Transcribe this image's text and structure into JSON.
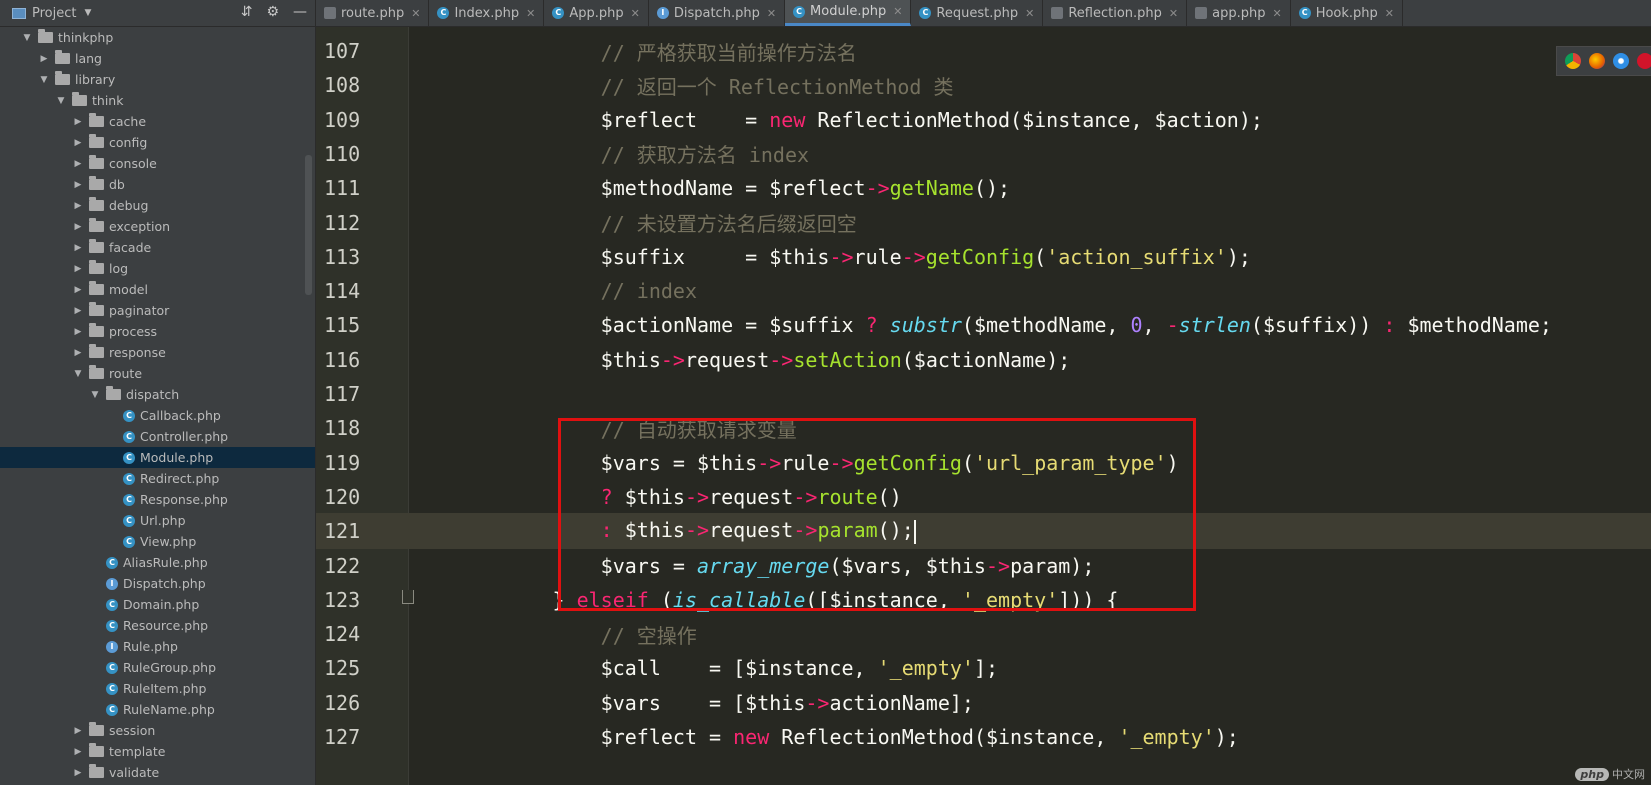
{
  "sidebar": {
    "title": "Project",
    "tree": [
      {
        "label": "thinkphp",
        "type": "folder",
        "depth": 0,
        "open": true
      },
      {
        "label": "lang",
        "type": "folder",
        "depth": 1,
        "open": false
      },
      {
        "label": "library",
        "type": "folder",
        "depth": 1,
        "open": true
      },
      {
        "label": "think",
        "type": "folder",
        "depth": 2,
        "open": true
      },
      {
        "label": "cache",
        "type": "folder",
        "depth": 3,
        "open": false
      },
      {
        "label": "config",
        "type": "folder",
        "depth": 3,
        "open": false
      },
      {
        "label": "console",
        "type": "folder",
        "depth": 3,
        "open": false
      },
      {
        "label": "db",
        "type": "folder",
        "depth": 3,
        "open": false
      },
      {
        "label": "debug",
        "type": "folder",
        "depth": 3,
        "open": false
      },
      {
        "label": "exception",
        "type": "folder",
        "depth": 3,
        "open": false
      },
      {
        "label": "facade",
        "type": "folder",
        "depth": 3,
        "open": false
      },
      {
        "label": "log",
        "type": "folder",
        "depth": 3,
        "open": false
      },
      {
        "label": "model",
        "type": "folder",
        "depth": 3,
        "open": false
      },
      {
        "label": "paginator",
        "type": "folder",
        "depth": 3,
        "open": false
      },
      {
        "label": "process",
        "type": "folder",
        "depth": 3,
        "open": false
      },
      {
        "label": "response",
        "type": "folder",
        "depth": 3,
        "open": false
      },
      {
        "label": "route",
        "type": "folder",
        "depth": 3,
        "open": true
      },
      {
        "label": "dispatch",
        "type": "folder",
        "depth": 4,
        "open": true
      },
      {
        "label": "Callback.php",
        "type": "php",
        "depth": 5
      },
      {
        "label": "Controller.php",
        "type": "php",
        "depth": 5
      },
      {
        "label": "Module.php",
        "type": "php",
        "depth": 5,
        "selected": true
      },
      {
        "label": "Redirect.php",
        "type": "php",
        "depth": 5
      },
      {
        "label": "Response.php",
        "type": "php",
        "depth": 5
      },
      {
        "label": "Url.php",
        "type": "php",
        "depth": 5
      },
      {
        "label": "View.php",
        "type": "php",
        "depth": 5
      },
      {
        "label": "AliasRule.php",
        "type": "php",
        "depth": 4
      },
      {
        "label": "Dispatch.php",
        "type": "php-abstract",
        "depth": 4
      },
      {
        "label": "Domain.php",
        "type": "php",
        "depth": 4
      },
      {
        "label": "Resource.php",
        "type": "php",
        "depth": 4
      },
      {
        "label": "Rule.php",
        "type": "php-abstract",
        "depth": 4
      },
      {
        "label": "RuleGroup.php",
        "type": "php",
        "depth": 4
      },
      {
        "label": "RuleItem.php",
        "type": "php",
        "depth": 4
      },
      {
        "label": "RuleName.php",
        "type": "php",
        "depth": 4
      },
      {
        "label": "session",
        "type": "folder",
        "depth": 3,
        "open": false
      },
      {
        "label": "template",
        "type": "folder",
        "depth": 3,
        "open": false
      },
      {
        "label": "validate",
        "type": "folder",
        "depth": 3,
        "open": false
      }
    ]
  },
  "tabs": [
    {
      "label": "route.php",
      "icon": "php-file-icon",
      "active": false
    },
    {
      "label": "Index.php",
      "icon": "php-class-icon",
      "active": false
    },
    {
      "label": "App.php",
      "icon": "php-class-icon",
      "active": false
    },
    {
      "label": "Dispatch.php",
      "icon": "php-abstract-icon",
      "active": false
    },
    {
      "label": "Module.php",
      "icon": "php-class-icon",
      "active": true
    },
    {
      "label": "Request.php",
      "icon": "php-class-icon",
      "active": false
    },
    {
      "label": "Reflection.php",
      "icon": "php-file-icon",
      "active": false
    },
    {
      "label": "app.php",
      "icon": "php-file-icon",
      "active": false
    },
    {
      "label": "Hook.php",
      "icon": "php-class-icon",
      "active": false
    }
  ],
  "editor": {
    "current_line": "121",
    "lines": [
      {
        "n": "107",
        "tokens": [
          [
            "",
            "                // 严格获取当前操作方法名",
            "cm"
          ]
        ]
      },
      {
        "n": "108",
        "tokens": [
          [
            "",
            "                // 返回一个 ReflectionMethod 类",
            "cm"
          ]
        ]
      },
      {
        "n": "109",
        "tokens": [
          [
            "",
            "                $reflect    = ",
            ""
          ],
          [
            "",
            "new",
            "kw"
          ],
          [
            "",
            " ReflectionMethod($instance, $action);",
            ""
          ]
        ]
      },
      {
        "n": "110",
        "tokens": [
          [
            "",
            "                // 获取方法名 index",
            "cm"
          ]
        ]
      },
      {
        "n": "111",
        "tokens": [
          [
            "",
            "                $methodName = $reflect",
            ""
          ],
          [
            "",
            "->",
            "op"
          ],
          [
            "",
            "getName",
            "fn"
          ],
          [
            "",
            "();",
            ""
          ]
        ]
      },
      {
        "n": "112",
        "tokens": [
          [
            "",
            "                // 未设置方法名后缀返回空",
            "cm"
          ]
        ]
      },
      {
        "n": "113",
        "tokens": [
          [
            "",
            "                $suffix     = $this",
            ""
          ],
          [
            "",
            "->",
            "op"
          ],
          [
            "",
            "rule",
            ""
          ],
          [
            "",
            "->",
            "op"
          ],
          [
            "",
            "getConfig",
            "fn"
          ],
          [
            "",
            "(",
            ""
          ],
          [
            "",
            "'action_suffix'",
            "st"
          ],
          [
            "",
            ");",
            ""
          ]
        ]
      },
      {
        "n": "114",
        "tokens": [
          [
            "",
            "                // index",
            "cm"
          ]
        ]
      },
      {
        "n": "115",
        "tokens": [
          [
            "",
            "                $actionName = $suffix ",
            ""
          ],
          [
            "",
            "?",
            "op"
          ],
          [
            "",
            "",
            " "
          ],
          [
            "",
            "substr",
            "it"
          ],
          [
            "",
            "($methodName, ",
            ""
          ],
          [
            "",
            "0",
            "nm"
          ],
          [
            "",
            ", ",
            ""
          ],
          [
            "",
            "-",
            "op"
          ],
          [
            "",
            "strlen",
            "it"
          ],
          [
            "",
            "($suffix)) ",
            ""
          ],
          [
            "",
            ":",
            "op"
          ],
          [
            "",
            "",
            " "
          ],
          [
            "",
            "$methodName;",
            ""
          ]
        ]
      },
      {
        "n": "116",
        "tokens": [
          [
            "",
            "                $this",
            ""
          ],
          [
            "",
            "->",
            "op"
          ],
          [
            "",
            "request",
            ""
          ],
          [
            "",
            "->",
            "op"
          ],
          [
            "",
            "setAction",
            "fn"
          ],
          [
            "",
            "($actionName);",
            ""
          ]
        ]
      },
      {
        "n": "117",
        "tokens": [
          [
            "",
            "",
            ""
          ]
        ]
      },
      {
        "n": "118",
        "tokens": [
          [
            "",
            "                // 自动获取请求变量",
            "cm"
          ]
        ]
      },
      {
        "n": "119",
        "tokens": [
          [
            "",
            "                $vars = $this",
            ""
          ],
          [
            "",
            "->",
            "op"
          ],
          [
            "",
            "rule",
            ""
          ],
          [
            "",
            "->",
            "op"
          ],
          [
            "",
            "getConfig",
            "fn"
          ],
          [
            "",
            "(",
            ""
          ],
          [
            "",
            "'url_param_type'",
            "st"
          ],
          [
            "",
            ")",
            ""
          ]
        ]
      },
      {
        "n": "120",
        "tokens": [
          [
            "",
            "                ",
            ""
          ],
          [
            "",
            "?",
            "op"
          ],
          [
            "",
            "",
            " "
          ],
          [
            "",
            "$this",
            ""
          ],
          [
            "",
            "->",
            "op"
          ],
          [
            "",
            "request",
            ""
          ],
          [
            "",
            "->",
            "op"
          ],
          [
            "",
            "route",
            "fn"
          ],
          [
            "",
            "()",
            ""
          ]
        ]
      },
      {
        "n": "121",
        "tokens": [
          [
            "",
            "                ",
            ""
          ],
          [
            "",
            ":",
            "op"
          ],
          [
            "",
            "",
            " "
          ],
          [
            "",
            "$this",
            ""
          ],
          [
            "",
            "->",
            "op"
          ],
          [
            "",
            "request",
            ""
          ],
          [
            "",
            "->",
            "op"
          ],
          [
            "",
            "param",
            "fn"
          ],
          [
            "",
            "();",
            ""
          ]
        ]
      },
      {
        "n": "122",
        "tokens": [
          [
            "",
            "                $vars = ",
            ""
          ],
          [
            "",
            "array_merge",
            "it"
          ],
          [
            "",
            "($vars, $this",
            ""
          ],
          [
            "",
            "->",
            "op"
          ],
          [
            "",
            "param);",
            ""
          ]
        ]
      },
      {
        "n": "123",
        "tokens": [
          [
            "",
            "            } ",
            ""
          ],
          [
            "",
            "elseif",
            "kw"
          ],
          [
            "",
            "",
            " "
          ],
          [
            "",
            "(",
            ""
          ],
          [
            "",
            "is_callable",
            "it"
          ],
          [
            "",
            "([$instance, ",
            ""
          ],
          [
            "",
            "'_empty'",
            "st"
          ],
          [
            "",
            "])) {",
            ""
          ]
        ]
      },
      {
        "n": "124",
        "tokens": [
          [
            "",
            "                // 空操作",
            "cm"
          ]
        ]
      },
      {
        "n": "125",
        "tokens": [
          [
            "",
            "                $call    = [$instance, ",
            ""
          ],
          [
            "",
            "'_empty'",
            "st"
          ],
          [
            "",
            "];",
            ""
          ]
        ]
      },
      {
        "n": "126",
        "tokens": [
          [
            "",
            "                $vars    = [$this",
            ""
          ],
          [
            "",
            "->",
            "op"
          ],
          [
            "",
            "actionName];",
            ""
          ]
        ]
      },
      {
        "n": "127",
        "tokens": [
          [
            "",
            "                $reflect = ",
            ""
          ],
          [
            "",
            "new",
            "kw"
          ],
          [
            "",
            "",
            " "
          ],
          [
            "",
            "ReflectionMethod($instance, ",
            ""
          ],
          [
            "",
            "'_empty'",
            "st"
          ],
          [
            "",
            ");",
            ""
          ]
        ]
      }
    ]
  },
  "browser_icons": [
    "chrome-icon",
    "firefox-icon",
    "safari-icon",
    "opera-icon"
  ],
  "watermark": {
    "badge": "php",
    "text": "中文网"
  },
  "colors": {
    "background": "#272822",
    "comment": "#75715e",
    "keyword": "#f92672",
    "function": "#a6e22e",
    "string": "#e6db74",
    "number": "#ae81ff",
    "builtin": "#66d9ef",
    "highlight_box": "#e01010"
  }
}
